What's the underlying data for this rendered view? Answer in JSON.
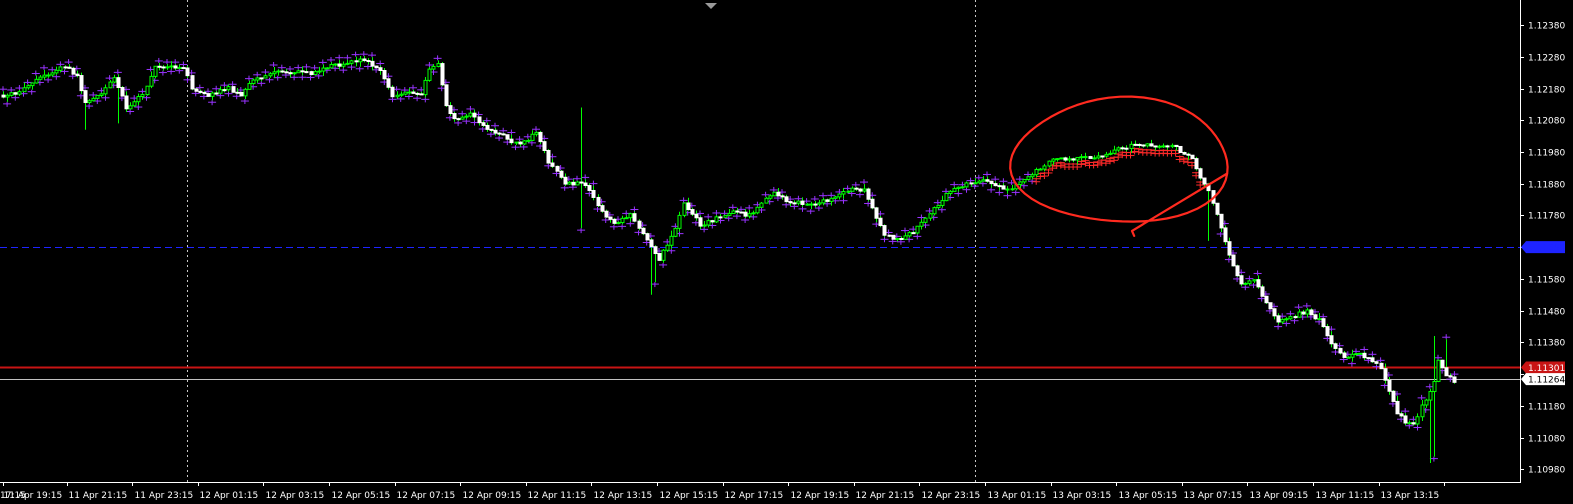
{
  "chart_data": {
    "type": "candlestick",
    "symbol_timeframe": "",
    "colors": {
      "background": "#000000",
      "frame": "#ffffff",
      "bull_body": "#000000",
      "bull_outline": "#00ff00",
      "bear_body": "#ffffff",
      "wick": "#00ff00",
      "indicator_marks": "#9933ff",
      "indicator_marks_highlight": "#ff2a2a",
      "annotation_circle": "#ff2a1f",
      "blue_line": "#1e24ff",
      "red_line": "#c81414",
      "gray_line": "#c0c0c0",
      "vline": "#c8c8c8"
    },
    "y_axis": {
      "min": 1.1094,
      "max": 1.1244,
      "tick_values": [
        1.1238,
        1.1228,
        1.1218,
        1.1208,
        1.1198,
        1.1188,
        1.1178,
        1.1168,
        1.1158,
        1.1148,
        1.1138,
        1.1128,
        1.1118,
        1.1108,
        1.1098
      ],
      "tick_labels": [
        "1.12380",
        "1.12280",
        "1.12180",
        "1.12080",
        "1.11980",
        "1.11880",
        "1.11780",
        "1.11680",
        "1.11580",
        "1.11480",
        "1.11380",
        "1.11280",
        "1.11180",
        "1.11080",
        "1.10980"
      ]
    },
    "x_axis": {
      "tick_bar_index": [
        0,
        16,
        32,
        48,
        64,
        80,
        96,
        112,
        128,
        144,
        160,
        176,
        192,
        208,
        224,
        240,
        256,
        272,
        288,
        304,
        320,
        336,
        352
      ],
      "tick_labels": [
        "17:15",
        "11 Apr 19:15",
        "11 Apr 21:15",
        "11 Apr 23:15",
        "12 Apr 01:15",
        "12 Apr 03:15",
        "12 Apr 05:15",
        "12 Apr 07:15",
        "12 Apr 09:15",
        "12 Apr 11:15",
        "12 Apr 13:15",
        "12 Apr 15:15",
        "12 Apr 17:15",
        "12 Apr 19:15",
        "12 Apr 21:15",
        "12 Apr 23:15",
        "13 Apr 01:15",
        "13 Apr 03:15",
        "13 Apr 05:15",
        "13 Apr 07:15",
        "13 Apr 09:15",
        "13 Apr 11:15",
        "13 Apr 13:15"
      ]
    },
    "vertical_lines_at_bar": [
      45,
      237
    ],
    "horizontal_lines": [
      {
        "price": 1.1168,
        "label": "1.11680",
        "style": "dashed",
        "color_key": "blue_line"
      },
      {
        "price": 1.11301,
        "label": "1.11301",
        "style": "solid",
        "color_key": "red_line"
      },
      {
        "price": 1.11264,
        "label": "1.11264",
        "style": "solid",
        "color_key": "gray_line"
      }
    ],
    "current_price": 1.11264,
    "annotation": {
      "type": "freehand-circle",
      "around_bars": [
        250,
        294
      ],
      "price_range": [
        1.1178,
        1.1211
      ]
    },
    "bars": {
      "count": 355,
      "anchors": [
        [
          0,
          1.1215
        ],
        [
          5,
          1.1218
        ],
        [
          10,
          1.1222
        ],
        [
          15,
          1.1225
        ],
        [
          18,
          1.1222
        ],
        [
          20,
          1.1213
        ],
        [
          24,
          1.1216
        ],
        [
          27,
          1.1222
        ],
        [
          30,
          1.1212
        ],
        [
          34,
          1.1216
        ],
        [
          37,
          1.1225
        ],
        [
          44,
          1.1225
        ],
        [
          46,
          1.1218
        ],
        [
          50,
          1.1216
        ],
        [
          55,
          1.1218
        ],
        [
          58,
          1.1216
        ],
        [
          61,
          1.1221
        ],
        [
          66,
          1.1223
        ],
        [
          70,
          1.1223
        ],
        [
          76,
          1.1223
        ],
        [
          80,
          1.1225
        ],
        [
          84,
          1.1226
        ],
        [
          88,
          1.1227
        ],
        [
          92,
          1.1224
        ],
        [
          95,
          1.1215
        ],
        [
          99,
          1.1217
        ],
        [
          102,
          1.1216
        ],
        [
          104,
          1.1224
        ],
        [
          106,
          1.1226
        ],
        [
          108,
          1.1213
        ],
        [
          110,
          1.1208
        ],
        [
          114,
          1.121
        ],
        [
          118,
          1.1205
        ],
        [
          122,
          1.1203
        ],
        [
          126,
          1.12
        ],
        [
          130,
          1.1204
        ],
        [
          133,
          1.1195
        ],
        [
          137,
          1.1188
        ],
        [
          142,
          1.1188
        ],
        [
          145,
          1.1181
        ],
        [
          149,
          1.1175
        ],
        [
          153,
          1.1178
        ],
        [
          157,
          1.117
        ],
        [
          160,
          1.1164
        ],
        [
          164,
          1.1174
        ],
        [
          166,
          1.1182
        ],
        [
          170,
          1.1175
        ],
        [
          174,
          1.1177
        ],
        [
          178,
          1.1179
        ],
        [
          182,
          1.1178
        ],
        [
          186,
          1.1183
        ],
        [
          188,
          1.1185
        ],
        [
          192,
          1.1182
        ],
        [
          198,
          1.1182
        ],
        [
          202,
          1.1183
        ],
        [
          206,
          1.1186
        ],
        [
          210,
          1.1186
        ],
        [
          212,
          1.118
        ],
        [
          215,
          1.1172
        ],
        [
          219,
          1.117
        ],
        [
          223,
          1.1174
        ],
        [
          227,
          1.118
        ],
        [
          231,
          1.1186
        ],
        [
          235,
          1.1188
        ],
        [
          240,
          1.1189
        ],
        [
          245,
          1.1186
        ],
        [
          248,
          1.1189
        ],
        [
          252,
          1.1192
        ],
        [
          255,
          1.1195
        ],
        [
          260,
          1.1196
        ],
        [
          265,
          1.1196
        ],
        [
          270,
          1.1198
        ],
        [
          275,
          1.12
        ],
        [
          280,
          1.12
        ],
        [
          285,
          1.12
        ],
        [
          290,
          1.1196
        ],
        [
          292,
          1.119
        ],
        [
          294,
          1.1186
        ],
        [
          296,
          1.1178
        ],
        [
          298,
          1.117
        ],
        [
          300,
          1.1162
        ],
        [
          302,
          1.1156
        ],
        [
          305,
          1.1158
        ],
        [
          308,
          1.115
        ],
        [
          311,
          1.1144
        ],
        [
          314,
          1.1146
        ],
        [
          318,
          1.1148
        ],
        [
          321,
          1.1145
        ],
        [
          324,
          1.1138
        ],
        [
          327,
          1.1133
        ],
        [
          330,
          1.1135
        ],
        [
          333,
          1.1133
        ],
        [
          336,
          1.113
        ],
        [
          338,
          1.1122
        ],
        [
          340,
          1.1116
        ],
        [
          342,
          1.1113
        ],
        [
          344,
          1.1112
        ],
        [
          346,
          1.1118
        ],
        [
          348,
          1.1122
        ],
        [
          349,
          1.1126
        ],
        [
          350,
          1.1132
        ],
        [
          352,
          1.1128
        ],
        [
          354,
          1.1126
        ]
      ]
    }
  }
}
